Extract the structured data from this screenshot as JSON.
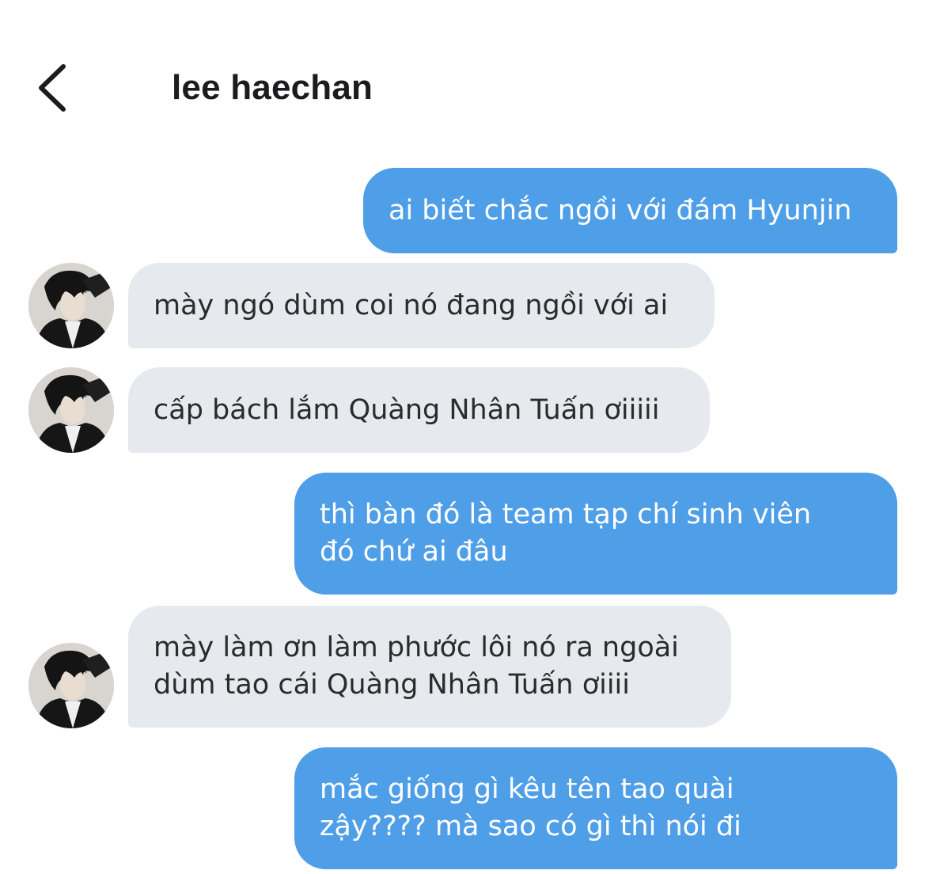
{
  "header": {
    "title": "lee haechan",
    "back_icon": "chevron-left-icon"
  },
  "colors": {
    "outgoing_bubble": "#4f9ee8",
    "incoming_bubble": "#e6eaee",
    "outgoing_text": "#ffffff",
    "incoming_text": "#2b2b2b"
  },
  "messages": [
    {
      "direction": "outgoing",
      "lines": [
        "ai biết chắc ngồi với đám Hyunjin"
      ]
    },
    {
      "direction": "incoming",
      "lines": [
        "mày ngó dùm coi nó đang ngồi với ai"
      ]
    },
    {
      "direction": "incoming",
      "lines": [
        "cấp bách lắm Quàng Nhân Tuấn ơiiiii"
      ]
    },
    {
      "direction": "outgoing",
      "lines": [
        "thì bàn đó là team tạp chí sinh viên",
        "đó chứ ai đâu"
      ]
    },
    {
      "direction": "incoming",
      "lines": [
        "mày làm ơn làm phước lôi nó ra ngoài",
        "dùm tao cái Quàng Nhân Tuấn ơiiii"
      ]
    },
    {
      "direction": "outgoing",
      "lines": [
        "mắc giống gì kêu tên tao quài",
        "zậy???? mà sao có gì thì nói đi"
      ]
    }
  ]
}
